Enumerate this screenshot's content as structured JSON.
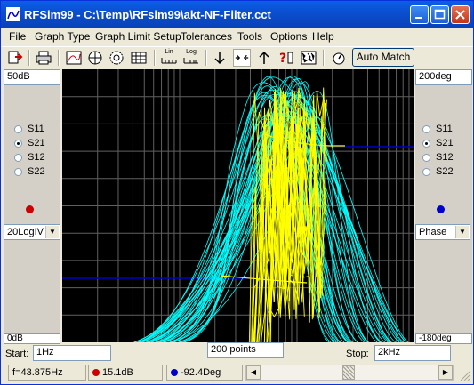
{
  "window": {
    "title": "RFSim99 - C:\\Temp\\RFsim99\\akt-NF-Filter.cct"
  },
  "menu": [
    "File",
    "Graph Type",
    "Graph Limit Setup",
    "Tolerances",
    "Tools",
    "Options",
    "Help"
  ],
  "toolbar": {
    "auto_match_label": "Auto Match",
    "lin_label": "Lin",
    "log_label": "Log"
  },
  "left_panel": {
    "top_value": "50dB",
    "bottom_value": "0dB",
    "params": [
      "S11",
      "S21",
      "S12",
      "S22"
    ],
    "selected": "S21",
    "marker_color": "#cc0000",
    "format_value": "20LogIV"
  },
  "right_panel": {
    "top_value": "200deg",
    "bottom_value": "-180deg",
    "params": [
      "S11",
      "S21",
      "S12",
      "S22"
    ],
    "selected": "S21",
    "marker_color": "#0000cc",
    "format_value": "Phase"
  },
  "sweep": {
    "start_label": "Start:",
    "start_value": "1Hz",
    "points_value": "200 points",
    "stop_label": "Stop:",
    "stop_value": "2kHz"
  },
  "status": {
    "frequency": "f=43.875Hz",
    "magnitude": "15.1dB",
    "phase": "-92.4Deg"
  },
  "colors": {
    "magnitude_trace": "#ffff00",
    "phase_trace": "#00ffff",
    "reference_line": "#0000cc",
    "plot_background": "#000000"
  }
}
